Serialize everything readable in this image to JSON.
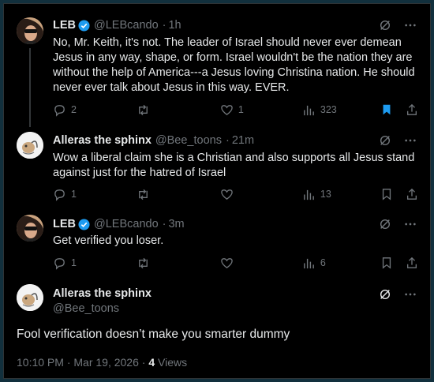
{
  "colors": {
    "background": "#000000",
    "text": "#e7e9ea",
    "muted": "#71767b",
    "verified": "#1d9bf0",
    "bookmark_active": "#1d9bf0"
  },
  "replies": [
    {
      "name": "LEB",
      "handle": "@LEBcando",
      "time": "1h",
      "verified": true,
      "text": "No, Mr. Keith, it's not.  The leader of Israel should never ever demean Jesus in any way, shape, or form.  Israel wouldn't be the nation they are without the help of America---a Jesus loving Christina nation.  He should never ever talk about Jesus in this way.   EVER.",
      "reply_count": "2",
      "repost_count": "",
      "like_count": "1",
      "view_count": "323",
      "bookmarked": true
    },
    {
      "name": "Alleras the sphinx",
      "handle": "@Bee_toons",
      "time": "21m",
      "verified": false,
      "text": "Wow a liberal claim she is a Christian and also supports all Jesus stand against just for the hatred of Israel",
      "reply_count": "1",
      "repost_count": "",
      "like_count": "",
      "view_count": "13",
      "bookmarked": false
    },
    {
      "name": "LEB",
      "handle": "@LEBcando",
      "time": "3m",
      "verified": true,
      "text": "Get verified you loser.",
      "reply_count": "1",
      "repost_count": "",
      "like_count": "",
      "view_count": "6",
      "bookmarked": false
    }
  ],
  "main_post": {
    "name": "Alleras the sphinx",
    "handle": "@Bee_toons",
    "text": "Fool verification doesn’t make you smarter dummy",
    "timestamp": "10:10 PM · Mar 19, 2026 ·",
    "views_count": "4",
    "views_label": "Views"
  },
  "icons": [
    "reply-icon",
    "repost-icon",
    "like-icon",
    "views-icon",
    "bookmark-icon",
    "share-icon",
    "grok-icon",
    "more-icon",
    "verified-badge-icon"
  ]
}
